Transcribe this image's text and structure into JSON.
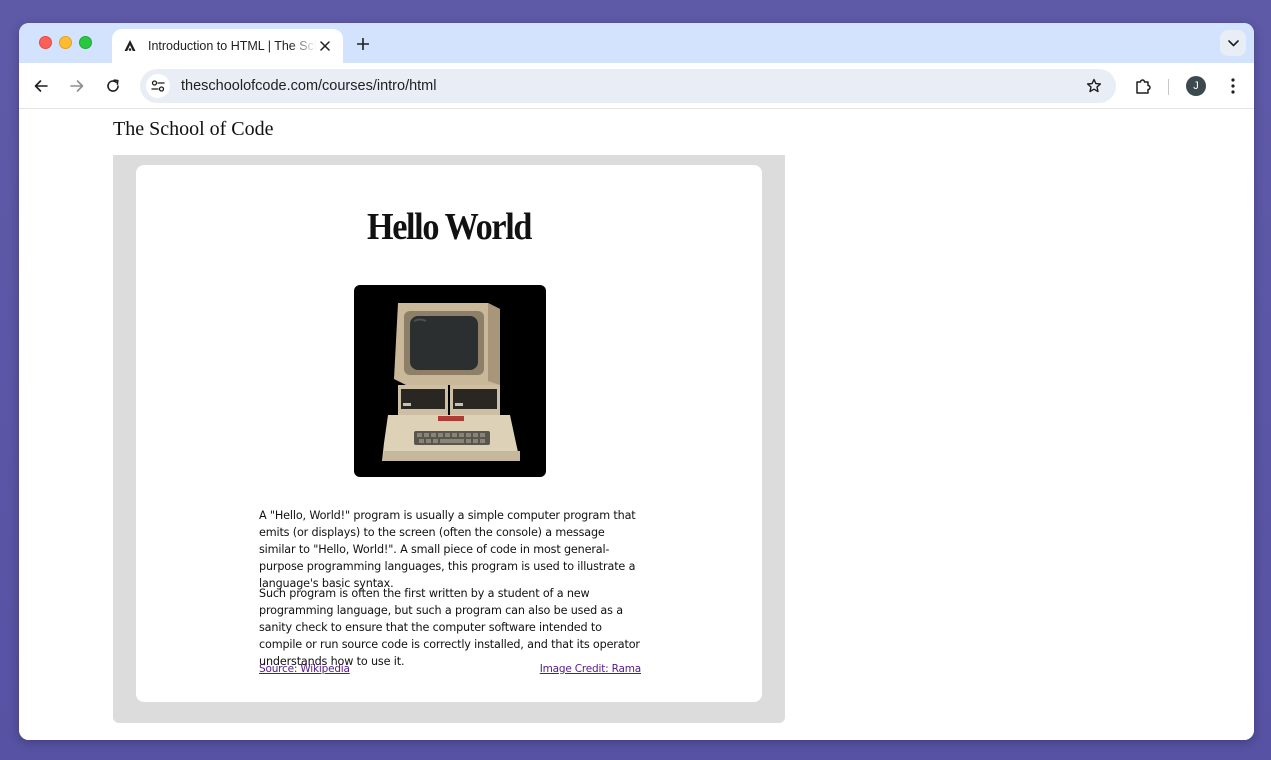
{
  "browser": {
    "tab": {
      "title": "Introduction to HTML | The School of Code"
    },
    "omnibox": {
      "url": "theschoolofcode.com/courses/intro/html"
    },
    "profile_initial": "J"
  },
  "page": {
    "site_title": "The School of Code",
    "heading": "Hello World",
    "paragraphs": [
      "A \"Hello, World!\" program is usually a simple computer program that emits (or displays) to the screen (often the console) a message similar to \"Hello, World!\". A small piece of code in most general-purpose programming languages, this program is used to illustrate a language's basic syntax.",
      "Such program is often the first written by a student of a new programming language, but such a program can also be used as a sanity check to ensure that the computer software intended to compile or run source code is correctly installed, and that its operator understands how to use it."
    ],
    "source_link": "Source: Wikipedia",
    "credit_link": "Image Credit: Rama",
    "image": {
      "icon": "apple-ii-computer-photo"
    }
  },
  "colors": {
    "tabstrip": "#d3e3fd",
    "omnibox": "#e9eef6",
    "frame": "#dddcdd",
    "link": "#551a8b"
  }
}
